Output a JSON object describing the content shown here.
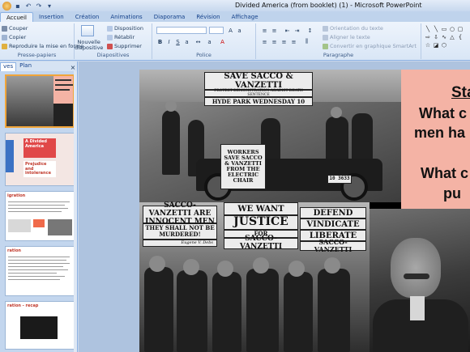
{
  "window": {
    "title": "Divided America (from booklet) (1) - Microsoft PowerPoint"
  },
  "tabs": [
    "Accueil",
    "Insertion",
    "Création",
    "Animations",
    "Diaporama",
    "Révision",
    "Affichage"
  ],
  "ribbon": {
    "clipboard": {
      "copy_cut": "Couper",
      "copy": "Copier",
      "format_painter": "Reproduire la mise en forme",
      "label": "Presse-papiers"
    },
    "slides": {
      "new_slide": "Nouvelle diapositive",
      "layout": "Disposition",
      "reset": "Rétablir",
      "delete": "Supprimer",
      "label": "Diapositives"
    },
    "font": {
      "label": "Police"
    },
    "paragraph": {
      "text_direction": "Orientation du texte",
      "align_text": "Aligner le texte",
      "smartart": "Convertir en graphique SmartArt",
      "label": "Paragraphe"
    }
  },
  "left_pane": {
    "tabs": [
      "ves",
      "Plan"
    ],
    "close": "×",
    "thumb_texts": [
      "A Divided America",
      "Prejudice and intolerance",
      "igration",
      "ration",
      "ration - recap"
    ]
  },
  "slide": {
    "signs": {
      "banner": "SAVE SACCO & VANZETTI",
      "banner_sub1": "PROTEST DEMONSTRATION AGAINST DEATH SENTENCE",
      "banner_sub2": "HYDE PARK WEDNESDAY 10",
      "car_sign": "WORKERS SAVE SACCO & VANZETTI FROM THE ELECTRIC CHAIR",
      "innocent": "SACCO-VANZETTI ARE INNOCENT MEN",
      "innocent2": "THEY SHALL NOT BE MURDERED!",
      "innocent_sig": "Eugene V. Debs",
      "justice1": "WE WANT",
      "justice2": "JUSTICE",
      "justice3": "FOR",
      "justice4": "SACCO-VANZETTI",
      "defend1": "DEFEND",
      "defend2": "VINDICATE",
      "defend3": "LIBERATE",
      "defend4": "SACCO-VANZETTI",
      "plate": "10 3633"
    },
    "text_box": [
      "Sta",
      "What c",
      "men ha",
      "",
      "What c",
      "pu"
    ]
  },
  "colors": {
    "pink_box": "#f4b3a5",
    "active_thumb_border": "#f0a53a",
    "thumb_heading_red": "#c0392b"
  }
}
